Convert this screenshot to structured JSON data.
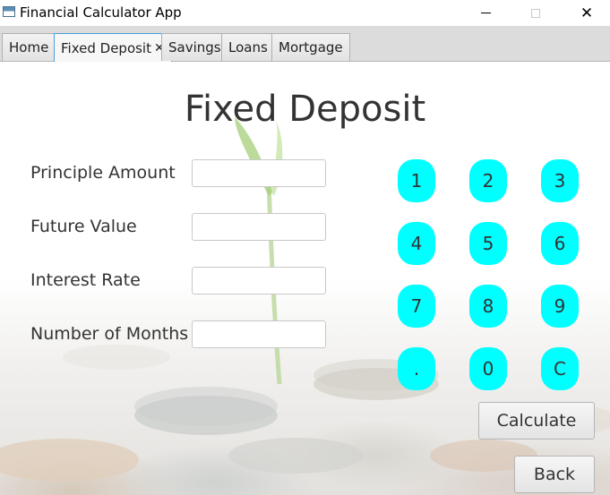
{
  "window": {
    "title": "Financial Calculator App",
    "minimize_icon": "minimize-icon",
    "maximize_icon": "maximize-icon",
    "close_glyph": "✕",
    "close_icon": "close-icon"
  },
  "tabs": [
    {
      "label": "Home",
      "active": false
    },
    {
      "label": "Fixed Deposit",
      "active": true,
      "close": "✕"
    },
    {
      "label": "Savings",
      "active": false
    },
    {
      "label": "Loans",
      "active": false
    },
    {
      "label": "Mortgage",
      "active": false
    }
  ],
  "main": {
    "title": "Fixed Deposit",
    "fields": [
      {
        "label": "Principle Amount",
        "value": ""
      },
      {
        "label": "Future Value",
        "value": ""
      },
      {
        "label": "Interest Rate",
        "value": ""
      },
      {
        "label": "Number of Months",
        "value": ""
      }
    ],
    "keypad": [
      "1",
      "2",
      "3",
      "4",
      "5",
      "6",
      "7",
      "8",
      "9",
      ".",
      "0",
      "C"
    ],
    "keypad_color": "#00ffff",
    "calculate_label": "Calculate",
    "back_label": "Back"
  }
}
